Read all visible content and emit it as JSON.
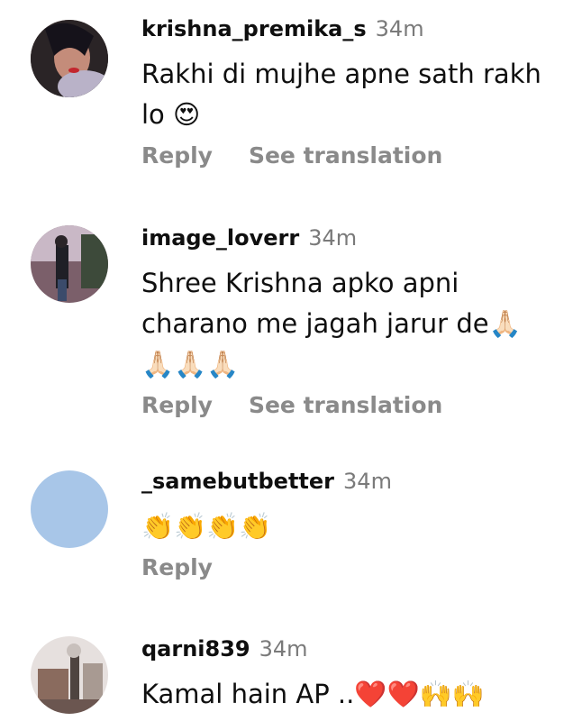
{
  "comments": [
    {
      "username": "krishna_premika_s",
      "time": "34m",
      "text": "Rakhi di mujhe apne sath rakh lo 😍",
      "reply_label": "Reply",
      "translate_label": "See translation"
    },
    {
      "username": "image_loverr",
      "time": "34m",
      "text": "Shree Krishna apko apni charano me jagah jarur de🙏🏻 🙏🏻🙏🏻🙏🏻",
      "reply_label": "Reply",
      "translate_label": "See translation"
    },
    {
      "username": "_samebutbetter",
      "time": "34m",
      "text": "👏👏👏👏",
      "reply_label": "Reply"
    },
    {
      "username": "qarni839",
      "time": "34m",
      "text": "Kamal hain AP ..❤️❤️🙌🙌"
    }
  ],
  "colors": {
    "username": "#0f0f0f",
    "timestamp": "#7a7a7a",
    "action": "#8a8a8a",
    "avatar_3": "#a8c6e8"
  }
}
